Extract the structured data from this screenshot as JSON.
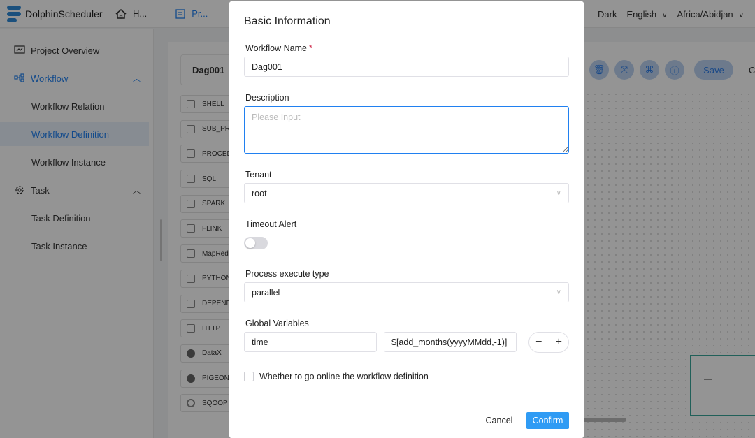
{
  "app": {
    "name": "DolphinScheduler"
  },
  "header": {
    "nav": [
      {
        "label": "H...",
        "icon": "home-icon"
      },
      {
        "label": "Pr...",
        "icon": "project-icon"
      }
    ],
    "theme_label": "Dark",
    "language_label": "English",
    "timezone_label": "Africa/Abidjan"
  },
  "sidebar": {
    "items": [
      {
        "label": "Project Overview",
        "icon": "chart-icon"
      },
      {
        "label": "Workflow",
        "icon": "workflow-icon"
      },
      {
        "label": "Workflow Relation"
      },
      {
        "label": "Workflow Definition"
      },
      {
        "label": "Workflow Instance"
      },
      {
        "label": "Task",
        "icon": "gear-icon"
      },
      {
        "label": "Task Definition"
      },
      {
        "label": "Task Instance"
      }
    ]
  },
  "workspace": {
    "dag_name": "Dag001",
    "tasks": [
      "SHELL",
      "SUB_PR",
      "PROCED",
      "SQL",
      "SPARK",
      "FLINK",
      "MapRed",
      "PYTHON",
      "DEPEND",
      "HTTP",
      "DataX",
      "PIGEON",
      "SQOOP"
    ],
    "toolbar": {
      "save_label": "Save",
      "close_label": "C"
    }
  },
  "modal": {
    "title": "Basic Information",
    "workflow_name": {
      "label": "Workflow Name",
      "required_mark": "*",
      "value": "Dag001"
    },
    "description": {
      "label": "Description",
      "placeholder": "Please Input"
    },
    "tenant": {
      "label": "Tenant",
      "value": "root"
    },
    "timeout_alert": {
      "label": "Timeout Alert",
      "enabled": false
    },
    "process_execute_type": {
      "label": "Process execute type",
      "value": "parallel"
    },
    "global_variables": {
      "label": "Global Variables",
      "key": "time",
      "value": "$[add_months(yyyyMMdd,-1)]",
      "minus": "−",
      "plus": "+"
    },
    "online_checkbox": {
      "label": "Whether to go online the workflow definition",
      "checked": false
    },
    "cancel_label": "Cancel",
    "confirm_label": "Confirm"
  },
  "colors": {
    "accent": "#2080f0",
    "confirm": "#2f9bf4",
    "required": "#d03050"
  }
}
